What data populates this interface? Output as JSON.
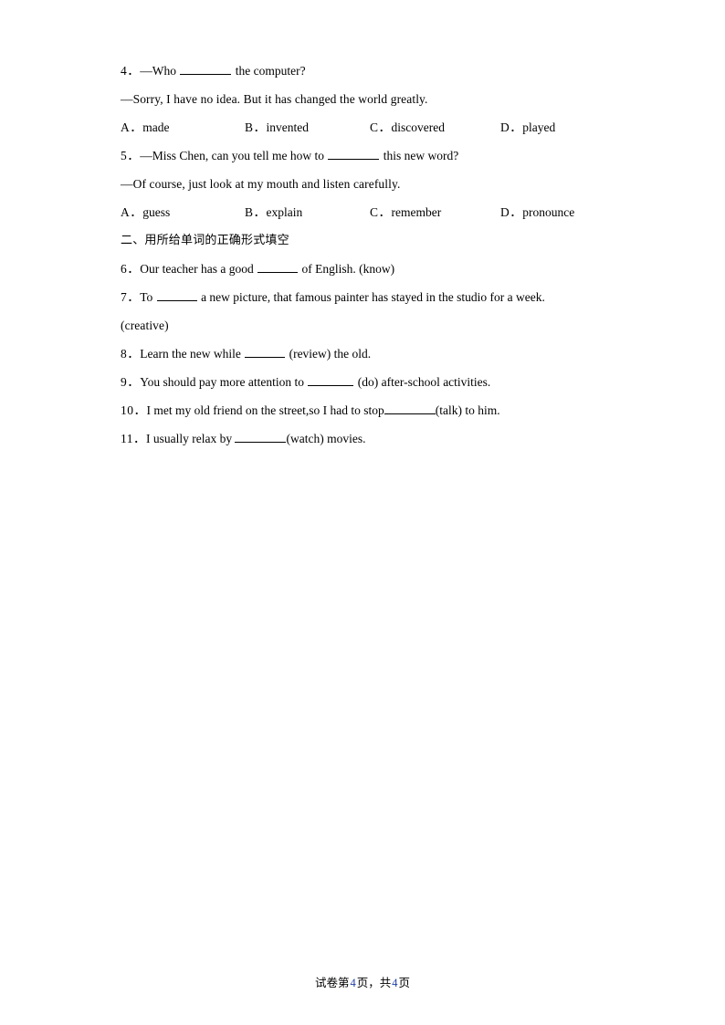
{
  "document": {
    "footer": {
      "prefix": "试卷第",
      "page_number": "4",
      "middle": "页，共",
      "total_pages": "4",
      "suffix": "页"
    }
  },
  "questions": [
    {
      "id": "q4",
      "number": "4．",
      "stem_before": "—Who ",
      "stem_after": " the computer?",
      "answer_line": "—Sorry, I have no idea. But it has changed the world greatly.",
      "options": [
        {
          "label": "A．",
          "text": "made"
        },
        {
          "label": "B．",
          "text": "invented"
        },
        {
          "label": "C．",
          "text": "discovered"
        },
        {
          "label": "D．",
          "text": "played"
        }
      ]
    },
    {
      "id": "q5",
      "number": "5．",
      "stem_before": "—Miss Chen, can you tell me how to ",
      "stem_after": " this new word?",
      "answer_line": "—Of course, just look at my mouth and listen carefully.",
      "options": [
        {
          "label": "A．",
          "text": "guess"
        },
        {
          "label": "B．",
          "text": "explain"
        },
        {
          "label": "C．",
          "text": "remember"
        },
        {
          "label": "D．",
          "text": "pronounce"
        }
      ]
    }
  ],
  "section_two": {
    "heading": "二、用所给单词的正确形式填空",
    "items": [
      {
        "id": "q6",
        "number": "6．",
        "before": "Our teacher has a good ",
        "after": " of English. (know)"
      },
      {
        "id": "q7",
        "number": "7．",
        "before": "To ",
        "after": " a new picture, that famous painter has stayed in the studio for a week.",
        "continuation": "(creative)"
      },
      {
        "id": "q8",
        "number": "8．",
        "before": "Learn the new while ",
        "after": " (review) the old."
      },
      {
        "id": "q9",
        "number": "9．",
        "before": "You should pay more attention to ",
        "after": " (do) after-school activities."
      },
      {
        "id": "q10",
        "number": "10．",
        "before": "I met my old friend on the street,so I had to stop",
        "after": "(talk) to him."
      },
      {
        "id": "q11",
        "number": "11．",
        "before": "I usually relax by ",
        "after": "(watch) movies."
      }
    ]
  }
}
